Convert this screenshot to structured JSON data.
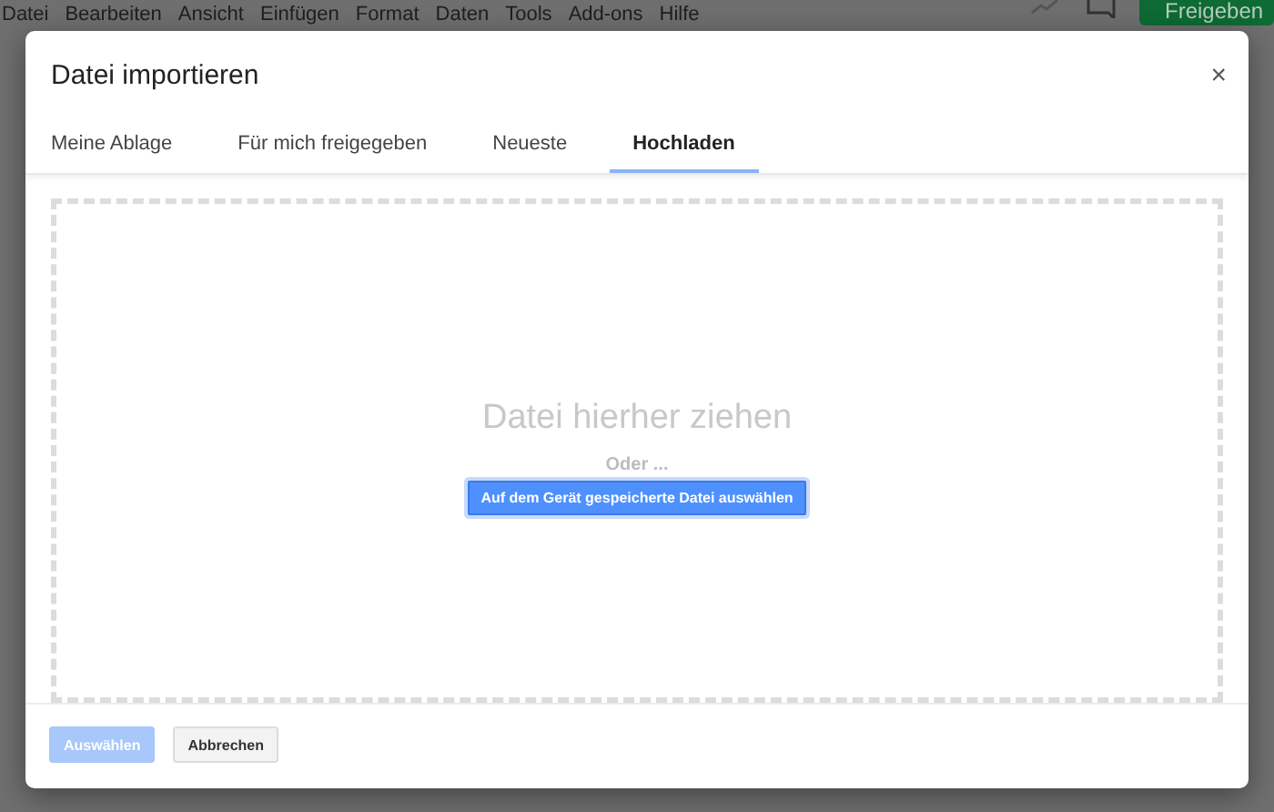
{
  "menu": [
    "Datei",
    "Bearbeiten",
    "Ansicht",
    "Einfügen",
    "Format",
    "Daten",
    "Tools",
    "Add-ons",
    "Hilfe"
  ],
  "share_button": "Freigeben",
  "dialog": {
    "title": "Datei importieren",
    "close": "×",
    "tabs": [
      {
        "label": "Meine Ablage",
        "selected": false
      },
      {
        "label": "Für mich freigegeben",
        "selected": false
      },
      {
        "label": "Neueste",
        "selected": false
      },
      {
        "label": "Hochladen",
        "selected": true
      }
    ],
    "dropzone": {
      "heading": "Datei hierher ziehen",
      "or": "Oder ...",
      "button": "Auf dem Gerät gespeicherte Datei auswählen"
    },
    "buttons": [
      {
        "label": "Auswählen",
        "kind": "primary",
        "disabled": true
      },
      {
        "label": "Abbrechen",
        "kind": "secondary",
        "disabled": false
      }
    ]
  }
}
